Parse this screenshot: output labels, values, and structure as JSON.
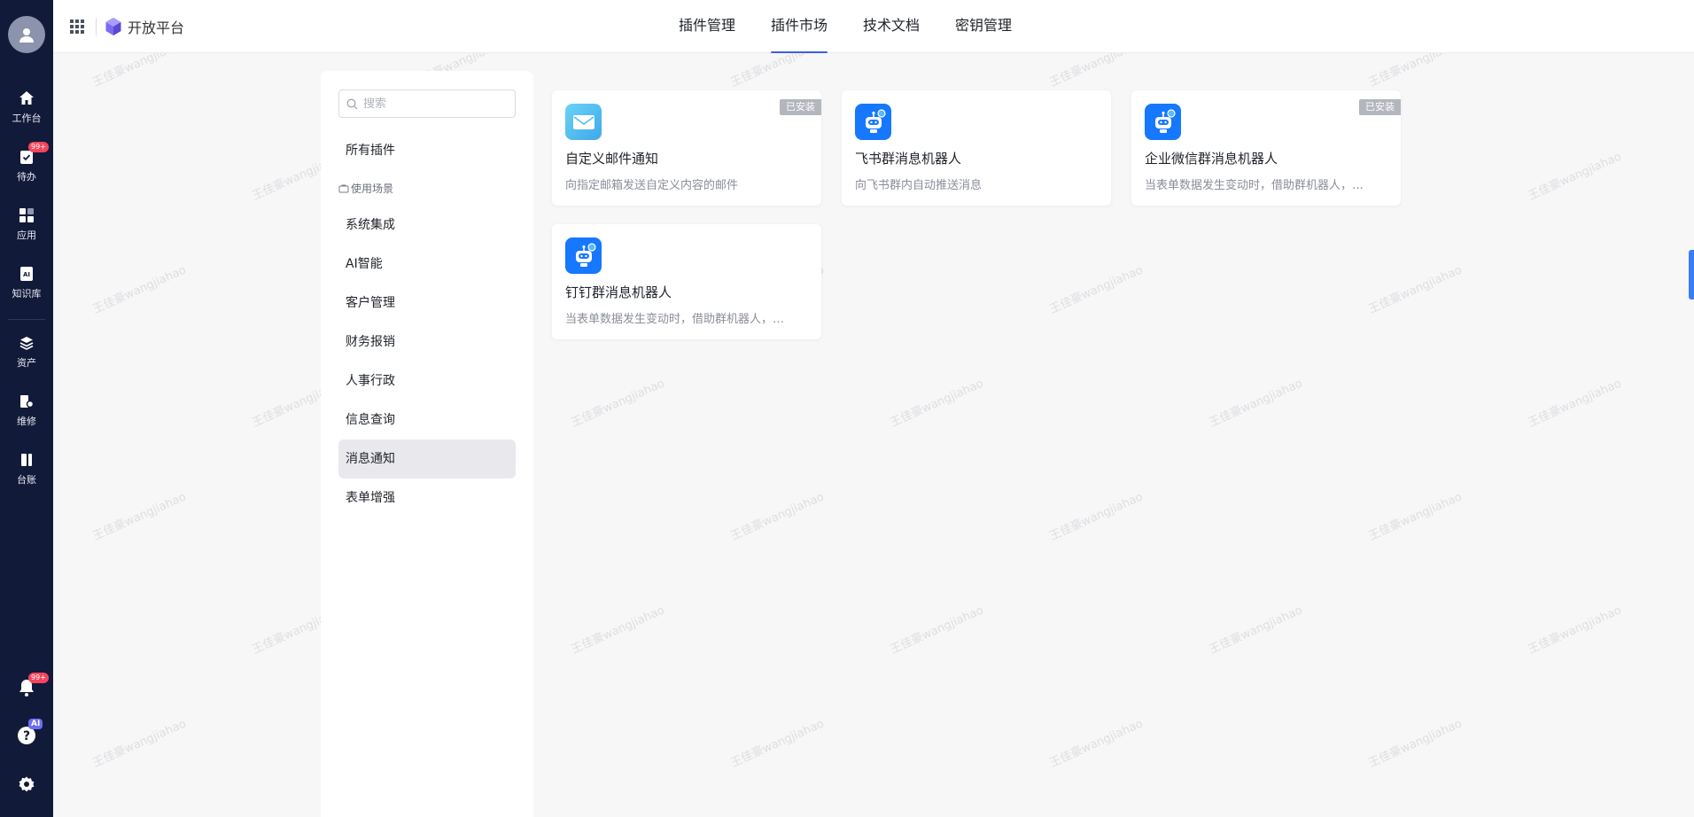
{
  "rail": {
    "items": [
      {
        "label": "工作台",
        "icon": "home-icon"
      },
      {
        "label": "待办",
        "icon": "todo-icon",
        "badge": "99+"
      },
      {
        "label": "应用",
        "icon": "apps-icon"
      },
      {
        "label": "知识库",
        "icon": "knowledge-icon"
      },
      {
        "label": "资产",
        "icon": "assets-icon"
      },
      {
        "label": "维修",
        "icon": "repair-icon"
      },
      {
        "label": "台账",
        "icon": "ledger-icon"
      }
    ],
    "bell_badge": "99+",
    "help_badge": "AI"
  },
  "header": {
    "brand_title": "开放平台",
    "tabs": [
      {
        "label": "插件管理",
        "active": false
      },
      {
        "label": "插件市场",
        "active": true
      },
      {
        "label": "技术文档",
        "active": false
      },
      {
        "label": "密钥管理",
        "active": false
      }
    ],
    "accent": "#3d5ee8"
  },
  "sidebar": {
    "search_placeholder": "搜索",
    "all_label": "所有插件",
    "scene_label": "使用场景",
    "categories": [
      {
        "label": "系统集成",
        "selected": false
      },
      {
        "label": "AI智能",
        "selected": false
      },
      {
        "label": "客户管理",
        "selected": false
      },
      {
        "label": "财务报销",
        "selected": false
      },
      {
        "label": "人事行政",
        "selected": false
      },
      {
        "label": "信息查询",
        "selected": false
      },
      {
        "label": "消息通知",
        "selected": true
      },
      {
        "label": "表单增强",
        "selected": false
      }
    ]
  },
  "plugins": [
    {
      "title": "自定义邮件通知",
      "desc": "向指定邮箱发送自定义内容的邮件",
      "installed": true,
      "installed_label": "已安装",
      "icon": "mail-icon"
    },
    {
      "title": "飞书群消息机器人",
      "desc": "向飞书群内自动推送消息",
      "installed": false,
      "installed_label": "",
      "icon": "robot-icon"
    },
    {
      "title": "企业微信群消息机器人",
      "desc": "当表单数据发生变动时，借助群机器人，…",
      "installed": true,
      "installed_label": "已安装",
      "icon": "robot-icon"
    },
    {
      "title": "钉钉群消息机器人",
      "desc": "当表单数据发生变动时，借助群机器人，…",
      "installed": false,
      "installed_label": "",
      "icon": "robot-icon"
    }
  ],
  "watermark": "王佳豪wangjiahao"
}
